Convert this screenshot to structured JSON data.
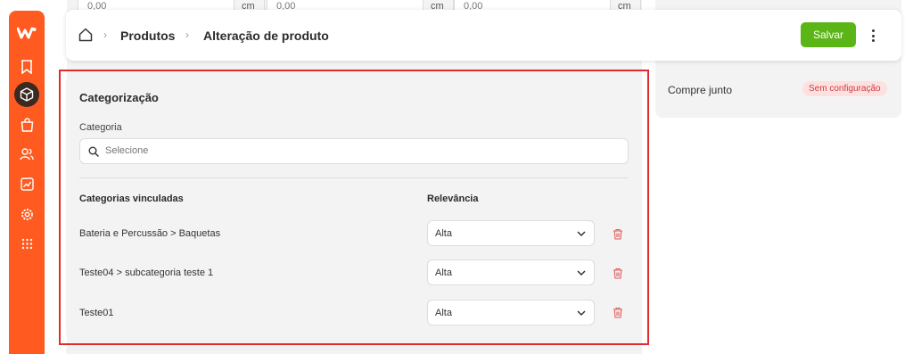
{
  "background_form": {
    "dimension_inputs": [
      {
        "value": "0,00",
        "unit": "cm"
      },
      {
        "value": "0,00",
        "unit": "cm"
      },
      {
        "value": "0,00",
        "unit": "cm"
      }
    ]
  },
  "side_panel": {
    "label": "Compre junto",
    "badge": "Sem configuração"
  },
  "header": {
    "breadcrumb": [
      "Produtos",
      "Alteração de produto"
    ],
    "save_label": "Salvar"
  },
  "categorization": {
    "title": "Categorização",
    "field_label": "Categoria",
    "search_placeholder": "Selecione",
    "col_linked": "Categorias vinculadas",
    "col_relevance": "Relevância",
    "rows": [
      {
        "category": "Bateria e Percussão > Baquetas",
        "relevance": "Alta"
      },
      {
        "category": "Teste04 > subcategoria teste 1",
        "relevance": "Alta"
      },
      {
        "category": "Teste01",
        "relevance": "Alta"
      }
    ]
  },
  "colors": {
    "sidebar": "#ff5a1f",
    "save_button": "#5cb516",
    "highlight_border": "#e22b2b",
    "trash": "#e05a5a"
  }
}
